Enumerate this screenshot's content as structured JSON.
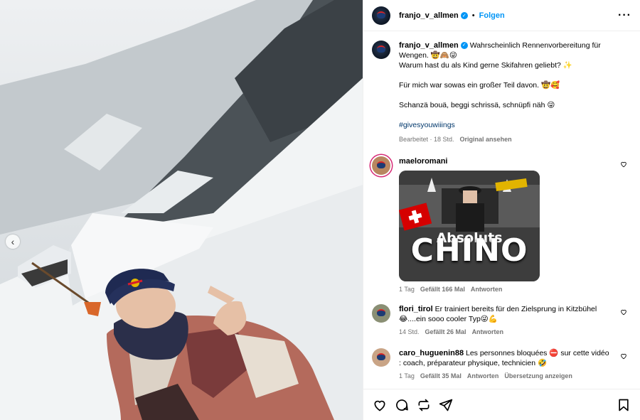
{
  "post": {
    "author": "franjo_v_allmen",
    "follow_label": "Folgen",
    "more_icon": "more-options-icon"
  },
  "caption": {
    "author": "franjo_v_allmen",
    "line1": "Wahrscheinlich Rennenvorbereitung für Wengen. 🤠🙈😜",
    "line2": "Warum hast du als Kind gerne Skifahren geliebt? ✨",
    "para2": "Für mich war sowas ein großer Teil davon. 🤠🥰",
    "para3": "Schanzä bouä, beggi schrissä, schnüpfi näh 😜",
    "hashtag": "#givesyouwiiings",
    "edited": "Bearbeitet · 18 Std.",
    "original": "Original ansehen"
  },
  "comments": [
    {
      "user": "maeloromani",
      "text": "",
      "gif_line1": "Absoluts",
      "gif_line2": "CHINO",
      "time": "1 Tag",
      "likes": "Gefällt 166 Mal",
      "reply": "Antworten",
      "avatar_color": "#b88760"
    },
    {
      "user": "flori_tirol",
      "text": "Er trainiert bereits für den Zielsprung in Kitzbühel 😂....ein sooo cooler Typ😜💪",
      "time": "14 Std.",
      "likes": "Gefällt 26 Mal",
      "reply": "Antworten",
      "avatar_color": "#8a8f74"
    },
    {
      "user": "caro_huguenin88",
      "text": "Les personnes bloquées ⛔ sur cette vidéo : coach, préparateur physique, technicien 🤣",
      "time": "1 Tag",
      "likes": "Gefällt 35 Mal",
      "reply": "Antworten",
      "translate": "Übersetzung anzeigen",
      "avatar_color": "#c9a486"
    }
  ],
  "actions": {
    "like_icon": "heart-icon",
    "comment_icon": "comment-icon",
    "share_icon": "repost-icon",
    "send_icon": "send-icon",
    "save_icon": "bookmark-icon"
  },
  "colors": {
    "link": "#0095f6",
    "hashtag": "#00376b",
    "muted": "#737373"
  }
}
